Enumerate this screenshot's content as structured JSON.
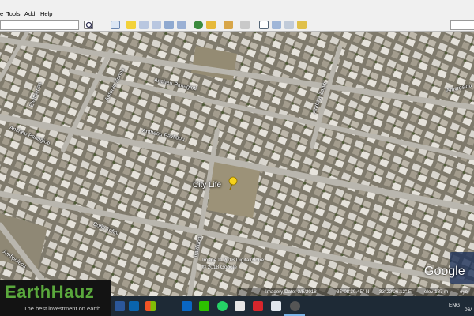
{
  "menubar": {
    "items": [
      {
        "label": "e"
      },
      {
        "label": "Tools"
      },
      {
        "label": "Add"
      },
      {
        "label": "Help"
      }
    ]
  },
  "toolbar": {
    "search_value": "",
    "buttons": [
      "search-icon",
      "sidebar-icon",
      "placemark-icon",
      "polygon-icon",
      "path-icon",
      "overlay-icon",
      "record-tour-icon",
      "historical-imagery-icon",
      "sun-icon",
      "planets-icon",
      "ruler-icon",
      "email-icon",
      "print-icon",
      "save-image-icon",
      "maps-icon"
    ]
  },
  "map": {
    "place_label": "City Life",
    "streets": [
      {
        "label": "Ancheu Panagioti"
      },
      {
        "label": "Antheou Pavlidou"
      },
      {
        "label": "Ancheu Panagioti"
      },
      {
        "label": "Antonio Xenou"
      },
      {
        "label": "Andrea Zapiti"
      },
      {
        "label": "Eleftherias"
      },
      {
        "label": "Sotiri Tofini"
      },
      {
        "label": "Amvrosiou"
      },
      {
        "label": "Iraklidon"
      },
      {
        "label": "Amfipoleos"
      }
    ],
    "copyright_lines": [
      "Image © 2018 DigitalGlobe",
      "© 2018 Google"
    ],
    "google_logo": "Google",
    "status": {
      "imagery_date": "Imagery Date: 3/5/2018",
      "lat": "35°08'30.45\" N",
      "lon": "33°22'06.12\" E",
      "elev": "elev  187 m",
      "eye": "eye"
    }
  },
  "overlay_logo": {
    "brand": "EarthHauz",
    "tagline": "The best investment on earth"
  },
  "taskbar": {
    "apps": [
      "word-icon",
      "outlook-icon",
      "windows-icon",
      "linkedin-icon",
      "wechat-icon",
      "whatsapp-icon",
      "paint-icon",
      "acrobat-icon",
      "photos-icon",
      "google-earth-icon"
    ],
    "tray_language": "ENG",
    "clock_date": "06/"
  },
  "colors": {
    "logo_green": "#5aa83c",
    "taskbar": "#1e2a36",
    "pin_yellow": "#f6d21b"
  }
}
